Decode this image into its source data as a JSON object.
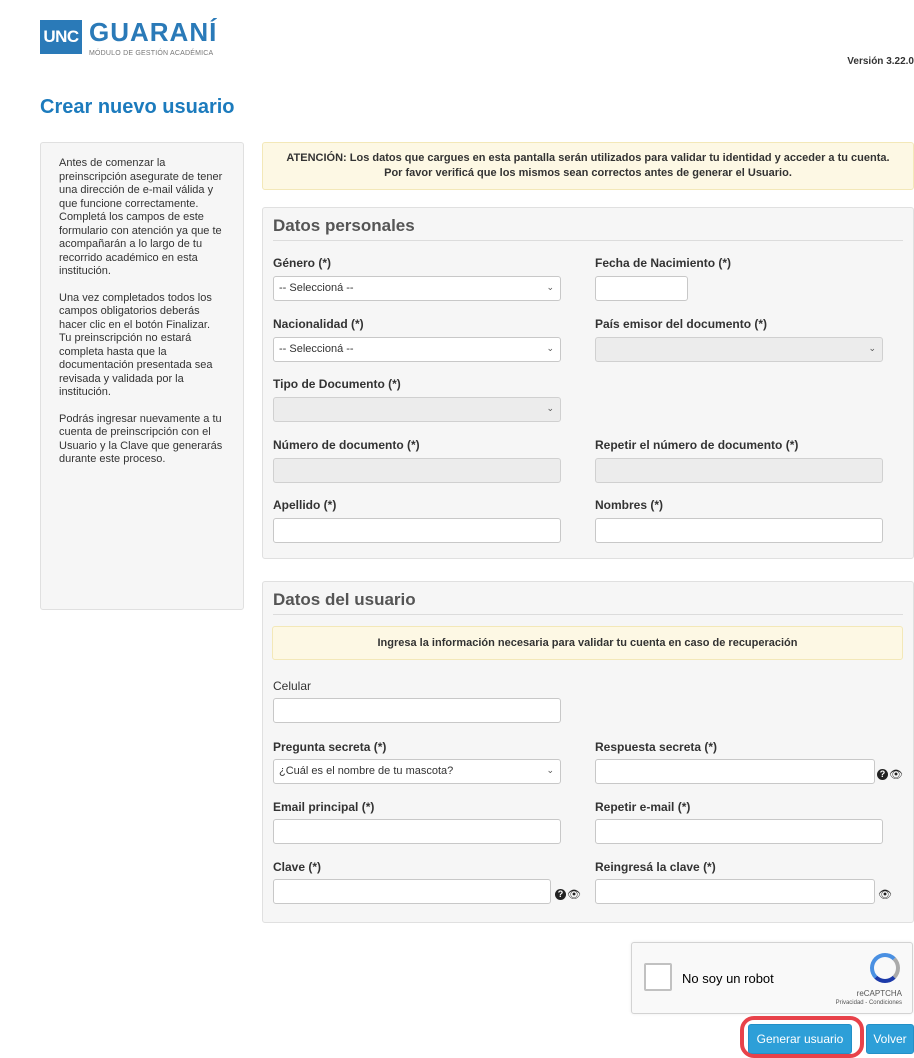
{
  "header": {
    "logo_unc": "UNC",
    "logo_name": "GUARANÍ",
    "logo_subtitle": "MÓDULO DE GESTIÓN ACADÉMICA",
    "version": "Versión 3.22.0"
  },
  "page_title": "Crear nuevo usuario",
  "info_panel": {
    "p1": "Antes de comenzar la preinscripción asegurate de tener una dirección de e-mail válida y que funcione correctamente. Completá los campos de este formulario con atención ya que te acompañarán a lo largo de tu recorrido académico en esta institución.",
    "p2a": "Una vez completados todos los campos obligatorios deberás hacer clic en el botón Finalizar.",
    "p2b": "Tu preinscripción no estará completa hasta que la documentación presentada sea revisada y validada por la institución.",
    "p3": "Podrás ingresar nuevamente a tu cuenta de preinscripción con el Usuario y la Clave que generarás durante este proceso."
  },
  "alert_top": "ATENCIÓN: Los datos que cargues en esta pantalla serán utilizados para validar tu identidad y acceder a tu cuenta. Por favor verificá que los mismos sean correctos antes de generar el Usuario.",
  "personal": {
    "title": "Datos personales",
    "genero_label": "Género (*)",
    "genero_value": "-- Seleccioná --",
    "fecha_label": "Fecha de Nacimiento (*)",
    "nacionalidad_label": "Nacionalidad (*)",
    "nacionalidad_value": "-- Seleccioná --",
    "pais_label": "País emisor del documento (*)",
    "tipo_doc_label": "Tipo de Documento (*)",
    "num_doc_label": "Número de documento (*)",
    "rep_doc_label": "Repetir el número de documento (*)",
    "apellido_label": "Apellido (*)",
    "nombres_label": "Nombres (*)"
  },
  "user": {
    "title": "Datos del usuario",
    "alert": "Ingresa la información necesaria para validar tu cuenta en caso de recuperación",
    "celular_label": "Celular",
    "pregunta_label": "Pregunta secreta (*)",
    "pregunta_value": "¿Cuál es el nombre de tu mascota?",
    "respuesta_label": "Respuesta secreta (*)",
    "email_label": "Email principal (*)",
    "rep_email_label": "Repetir e-mail (*)",
    "clave_label": "Clave (*)",
    "rep_clave_label": "Reingresá la clave (*)"
  },
  "captcha": {
    "text": "No soy un robot",
    "brand": "reCAPTCHA",
    "links": "Privacidad - Condiciones"
  },
  "buttons": {
    "generar": "Generar usuario",
    "volver": "Volver"
  },
  "colors": {
    "accent": "#2d9fd8",
    "title": "#1c7bbd",
    "alert_bg": "#fdf8e4",
    "highlight": "#e8424a"
  }
}
